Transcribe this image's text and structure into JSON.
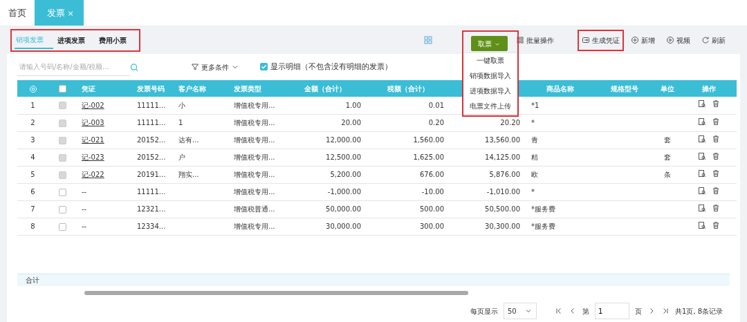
{
  "top_tabs": [
    {
      "label": "首页",
      "selected": false
    },
    {
      "label": "发票",
      "selected": true,
      "close": "×"
    }
  ],
  "sub_tab_bar": {
    "highlighted": true,
    "tabs": [
      {
        "label": "销项发票",
        "selected": true
      },
      {
        "label": "进项发票",
        "selected": false
      },
      {
        "label": "费用小票",
        "selected": false
      }
    ]
  },
  "fetch_menu": {
    "label": "取票",
    "expanded": true,
    "highlighted": true,
    "items": [
      "一键取票",
      "销项数据导入",
      "进项数据导入",
      "电票文件上传"
    ]
  },
  "actions": [
    {
      "kind": "batch",
      "label": "批量操作",
      "highlighted": false
    },
    {
      "kind": "voucher",
      "label": "生成凭证",
      "highlighted": true
    },
    {
      "kind": "add",
      "label": "新增",
      "highlighted": false
    },
    {
      "kind": "video",
      "label": "视频",
      "highlighted": false
    },
    {
      "kind": "refresh",
      "label": "刷新",
      "highlighted": false
    }
  ],
  "search": {
    "placeholder": "请输入号码/名称/金额/税额..."
  },
  "filter": {
    "label": "更多条件"
  },
  "show_detail": {
    "label": "显示明细（不包含没有明细的发票）",
    "checked": true
  },
  "table": {
    "columns": [
      {
        "kind": "icon"
      },
      {
        "kind": "checkbox",
        "checked": false
      },
      {
        "kind": "text",
        "label": "凭证"
      },
      {
        "kind": "text",
        "label": "发票号码"
      },
      {
        "kind": "text",
        "label": "客户名称"
      },
      {
        "kind": "text",
        "label": "发票类型"
      },
      {
        "kind": "text",
        "label": "金额（合计）"
      },
      {
        "kind": "text",
        "label": "税额（合计）"
      },
      {
        "kind": "hidden"
      },
      {
        "kind": "text",
        "label": "商品名称"
      },
      {
        "kind": "text",
        "label": "规格型号"
      },
      {
        "kind": "text",
        "label": "单位"
      },
      {
        "kind": "text",
        "label": "操作"
      }
    ],
    "rows": [
      {
        "index": "1",
        "disabled": true,
        "voucher": "记-002",
        "linked": true,
        "invoice_no": "11111...",
        "customer": "小",
        "invoice_type": "增值税专用...",
        "amount": "1.00",
        "tax": "0.01",
        "product": "*1"
      },
      {
        "index": "2",
        "disabled": true,
        "voucher": "记-003",
        "linked": true,
        "invoice_no": "11111...",
        "customer": "1",
        "invoice_type": "增值税专用...",
        "amount": "20.00",
        "tax": "0.20",
        "total": "20.20",
        "product": "*"
      },
      {
        "index": "3",
        "disabled": true,
        "voucher": "记-021",
        "linked": true,
        "invoice_no": "20152...",
        "customer": "达有...",
        "invoice_type": "增值税专用...",
        "amount": "12,000.00",
        "tax": "1,560.00",
        "total": "13,560.00",
        "product": "青",
        "unit": "套"
      },
      {
        "index": "4",
        "disabled": true,
        "voucher": "记-023",
        "linked": true,
        "invoice_no": "20152...",
        "customer": "户",
        "invoice_type": "增值税专用...",
        "amount": "12,500.00",
        "tax": "1,625.00",
        "total": "14,125.00",
        "product": "精",
        "unit": "套"
      },
      {
        "index": "5",
        "disabled": true,
        "voucher": "记-022",
        "linked": true,
        "invoice_no": "20191...",
        "customer": "翔实...",
        "invoice_type": "增值税专用...",
        "amount": "5,200.00",
        "tax": "676.00",
        "total": "5,876.00",
        "product": "欧",
        "unit": "条"
      },
      {
        "index": "6",
        "disabled": false,
        "voucher": "--",
        "linked": false,
        "invoice_no": "11111...",
        "invoice_type": "增值税专用...",
        "amount": "-1,000.00",
        "tax": "-10.00",
        "total": "-1,010.00",
        "product": "*"
      },
      {
        "index": "7",
        "disabled": false,
        "voucher": "--",
        "linked": false,
        "invoice_no": "12321...",
        "invoice_type": "增值税普通...",
        "amount": "50,000.00",
        "tax": "500.00",
        "total": "50,500.00",
        "product": "*服务费"
      },
      {
        "index": "8",
        "disabled": false,
        "voucher": "--",
        "linked": false,
        "invoice_no": "12334...",
        "invoice_type": "增值税专用...",
        "amount": "30,000.00",
        "tax": "300.00",
        "total": "30,300.00",
        "product": "*服务费"
      }
    ],
    "total_label": "合计"
  },
  "pagination": {
    "per_page_label": "每页显示",
    "per_page": "50",
    "page_prefix": "第",
    "page": "1",
    "page_suffix": "页",
    "summary": "共1页, 8条记录"
  }
}
